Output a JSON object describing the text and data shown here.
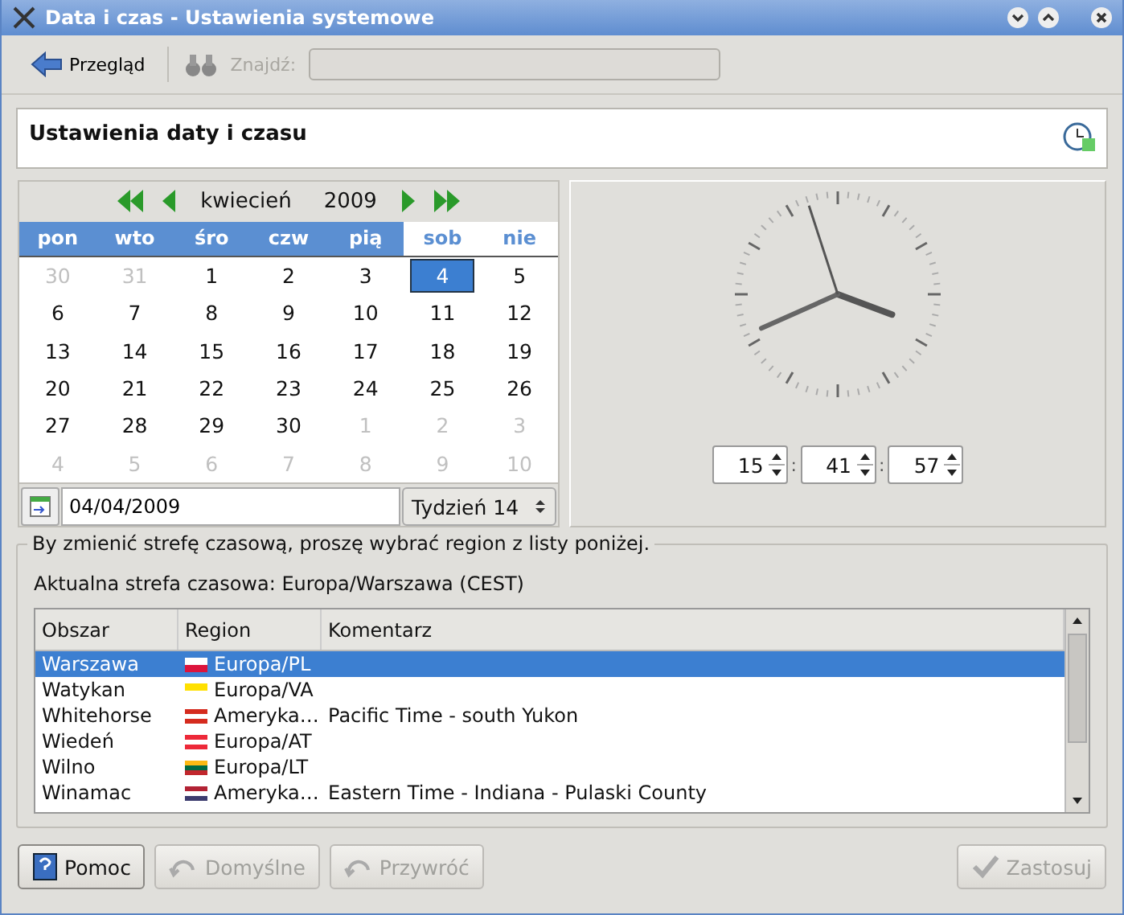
{
  "window": {
    "title": "Data i czas - Ustawienia systemowe"
  },
  "toolbar": {
    "back_label": "Przegląd",
    "search_label": "Znajdź:",
    "search_disabled": true
  },
  "header": {
    "title": "Ustawienia daty i czasu"
  },
  "calendar": {
    "month": "kwiecień",
    "year": "2009",
    "weekdays": [
      {
        "label": "pon",
        "weekend": false
      },
      {
        "label": "wto",
        "weekend": false
      },
      {
        "label": "śro",
        "weekend": false
      },
      {
        "label": "czw",
        "weekend": false
      },
      {
        "label": "pią",
        "weekend": false
      },
      {
        "label": "sob",
        "weekend": true
      },
      {
        "label": "nie",
        "weekend": true
      }
    ],
    "weeks": [
      [
        {
          "day": "30",
          "other_month": true,
          "selected": false
        },
        {
          "day": "31",
          "other_month": true,
          "selected": false
        },
        {
          "day": "1",
          "other_month": false,
          "selected": false
        },
        {
          "day": "2",
          "other_month": false,
          "selected": false
        },
        {
          "day": "3",
          "other_month": false,
          "selected": false
        },
        {
          "day": "4",
          "other_month": false,
          "selected": true
        },
        {
          "day": "5",
          "other_month": false,
          "selected": false
        }
      ],
      [
        {
          "day": "6",
          "other_month": false,
          "selected": false
        },
        {
          "day": "7",
          "other_month": false,
          "selected": false
        },
        {
          "day": "8",
          "other_month": false,
          "selected": false
        },
        {
          "day": "9",
          "other_month": false,
          "selected": false
        },
        {
          "day": "10",
          "other_month": false,
          "selected": false
        },
        {
          "day": "11",
          "other_month": false,
          "selected": false
        },
        {
          "day": "12",
          "other_month": false,
          "selected": false
        }
      ],
      [
        {
          "day": "13",
          "other_month": false,
          "selected": false
        },
        {
          "day": "14",
          "other_month": false,
          "selected": false
        },
        {
          "day": "15",
          "other_month": false,
          "selected": false
        },
        {
          "day": "16",
          "other_month": false,
          "selected": false
        },
        {
          "day": "17",
          "other_month": false,
          "selected": false
        },
        {
          "day": "18",
          "other_month": false,
          "selected": false
        },
        {
          "day": "19",
          "other_month": false,
          "selected": false
        }
      ],
      [
        {
          "day": "20",
          "other_month": false,
          "selected": false
        },
        {
          "day": "21",
          "other_month": false,
          "selected": false
        },
        {
          "day": "22",
          "other_month": false,
          "selected": false
        },
        {
          "day": "23",
          "other_month": false,
          "selected": false
        },
        {
          "day": "24",
          "other_month": false,
          "selected": false
        },
        {
          "day": "25",
          "other_month": false,
          "selected": false
        },
        {
          "day": "26",
          "other_month": false,
          "selected": false
        }
      ],
      [
        {
          "day": "27",
          "other_month": false,
          "selected": false
        },
        {
          "day": "28",
          "other_month": false,
          "selected": false
        },
        {
          "day": "29",
          "other_month": false,
          "selected": false
        },
        {
          "day": "30",
          "other_month": false,
          "selected": false
        },
        {
          "day": "1",
          "other_month": true,
          "selected": false
        },
        {
          "day": "2",
          "other_month": true,
          "selected": false
        },
        {
          "day": "3",
          "other_month": true,
          "selected": false
        }
      ],
      [
        {
          "day": "4",
          "other_month": true,
          "selected": false
        },
        {
          "day": "5",
          "other_month": true,
          "selected": false
        },
        {
          "day": "6",
          "other_month": true,
          "selected": false
        },
        {
          "day": "7",
          "other_month": true,
          "selected": false
        },
        {
          "day": "8",
          "other_month": true,
          "selected": false
        },
        {
          "day": "9",
          "other_month": true,
          "selected": false
        },
        {
          "day": "10",
          "other_month": true,
          "selected": false
        }
      ]
    ],
    "date_value": "04/04/2009",
    "week": "Tydzień 14"
  },
  "time": {
    "hours": "15",
    "minutes": "41",
    "seconds": "57",
    "separator": ":"
  },
  "timezone": {
    "group_title": "By zmienić strefę czasową, proszę wybrać region z listy poniżej.",
    "current": "Aktualna strefa czasowa: Europa/Warszawa (CEST)",
    "columns": [
      "Obszar",
      "Region",
      "Komentarz"
    ],
    "rows": [
      {
        "area": "Warszawa",
        "region": "Europa/PL",
        "comment": "",
        "selected": true
      },
      {
        "area": "Watykan",
        "region": "Europa/VA",
        "comment": "",
        "selected": false
      },
      {
        "area": "Whitehorse",
        "region": "Ameryka…",
        "comment": "Pacific Time - south Yukon",
        "selected": false
      },
      {
        "area": "Wiedeń",
        "region": "Europa/AT",
        "comment": "",
        "selected": false
      },
      {
        "area": "Wilno",
        "region": "Europa/LT",
        "comment": "",
        "selected": false
      },
      {
        "area": "Winamac",
        "region": "Ameryka…",
        "comment": "Eastern Time - Indiana - Pulaski County",
        "selected": false
      }
    ]
  },
  "buttons": [
    {
      "label": "Pomoc",
      "kind": "help",
      "disabled": false
    },
    {
      "label": "Domyślne",
      "kind": "defaults",
      "disabled": true
    },
    {
      "label": "Przywróć",
      "kind": "reset",
      "disabled": true
    },
    {
      "label": "Zastosuj",
      "kind": "apply",
      "disabled": true
    }
  ]
}
